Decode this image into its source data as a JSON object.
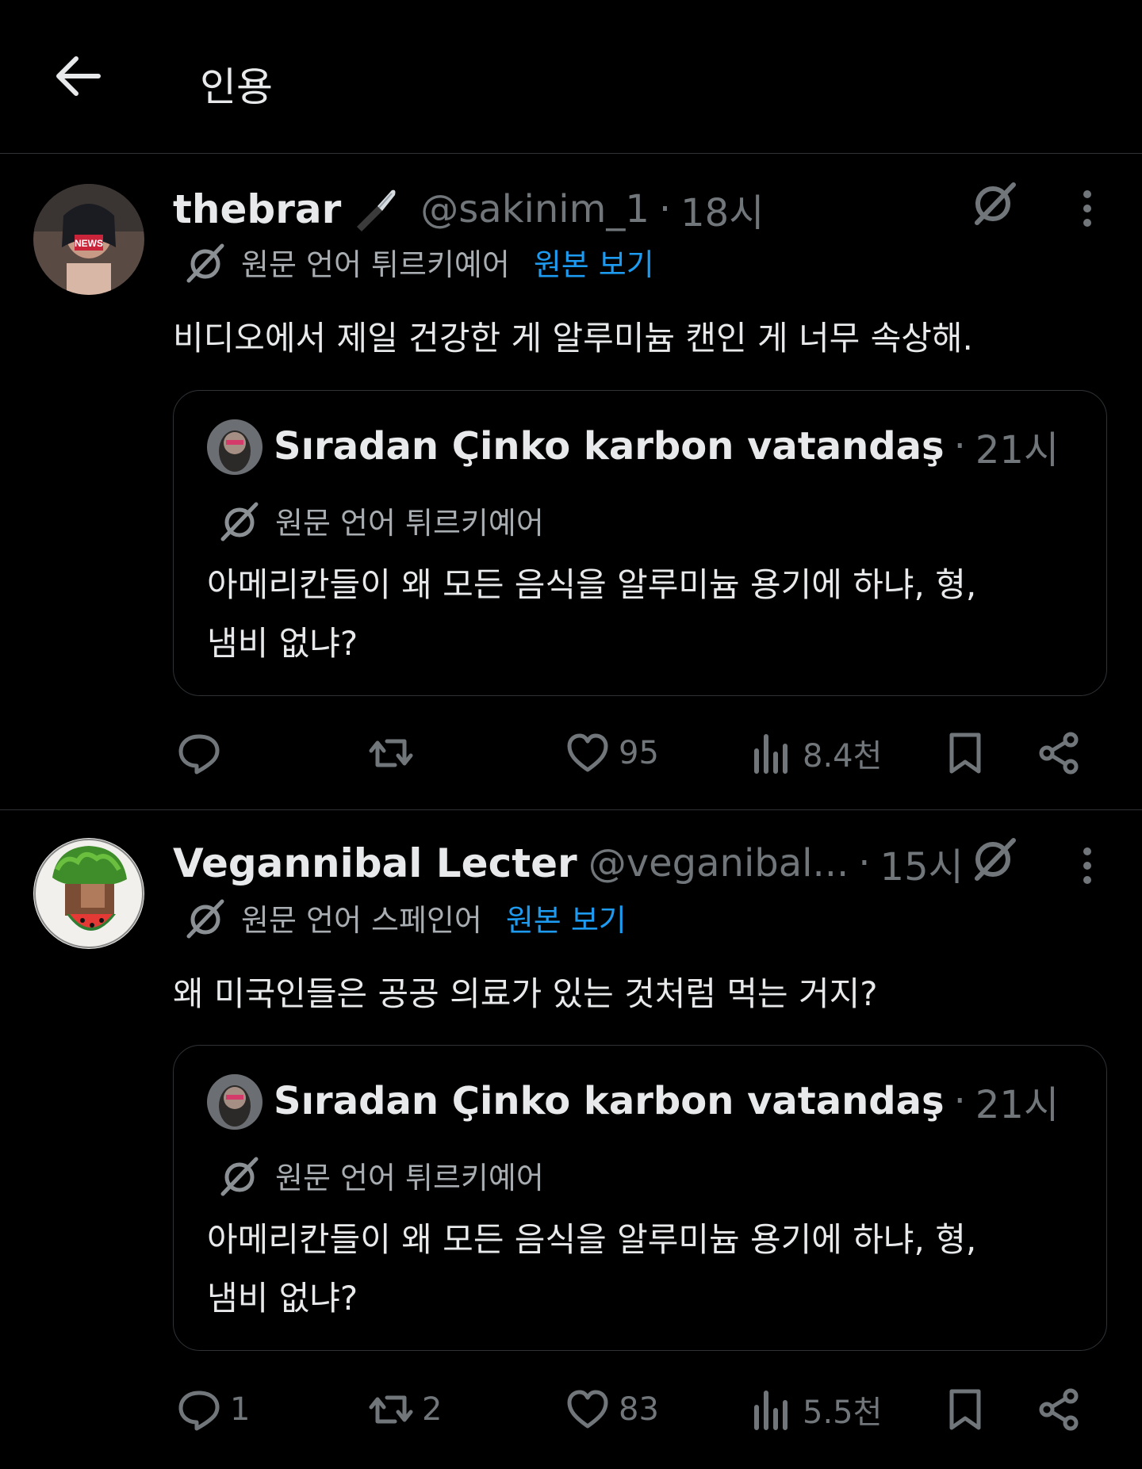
{
  "header": {
    "title": "인용"
  },
  "colors": {
    "background": "#000000",
    "text": "#e7e9ea",
    "muted": "#71767b",
    "link": "#1d9bf0",
    "border": "#2f3336"
  },
  "tweets": [
    {
      "name": "thebrar",
      "handle": "@sakinim_1",
      "sep": "·",
      "time": "18시",
      "avatar_badge": "NEWS",
      "lang_text": "원문 언어 튀르키예어",
      "show_original": "원본 보기",
      "text": "비디오에서 제일 건강한 게 알루미늄 캔인 게 너무 속상해.",
      "quote": {
        "name": "Sıradan Çinko karbon vatandaş",
        "sep": "·",
        "time": "21시",
        "lang_text": "원문 언어 튀르키예어",
        "line1": "아메리칸들이 왜 모든 음식을 알루미늄 용기에 하냐, 형,",
        "line2": "냄비 없냐?"
      },
      "actions": {
        "replies": "",
        "retweets": "",
        "likes": "95",
        "views": "8.4천"
      }
    },
    {
      "name": "Vegannibal Lecter",
      "handle": "@veganibal...",
      "sep": "·",
      "time": "15시",
      "lang_text": "원문 언어 스페인어",
      "show_original": "원본 보기",
      "text": "왜 미국인들은 공공 의료가 있는 것처럼 먹는 거지?",
      "quote": {
        "name": "Sıradan Çinko karbon vatandaş",
        "sep": "·",
        "time": "21시",
        "lang_text": "원문 언어 튀르키예어",
        "line1": "아메리칸들이 왜 모든 음식을 알루미늄 용기에 하냐, 형,",
        "line2": "냄비 없냐?"
      },
      "actions": {
        "replies": "1",
        "retweets": "2",
        "likes": "83",
        "views": "5.5천"
      }
    }
  ],
  "icons": [
    "back-arrow-icon",
    "knife-emoji-icon",
    "grok-slash-icon",
    "more-vertical-icon",
    "reply-icon",
    "retweet-icon",
    "like-heart-icon",
    "views-icon",
    "bookmark-icon",
    "share-icon"
  ]
}
